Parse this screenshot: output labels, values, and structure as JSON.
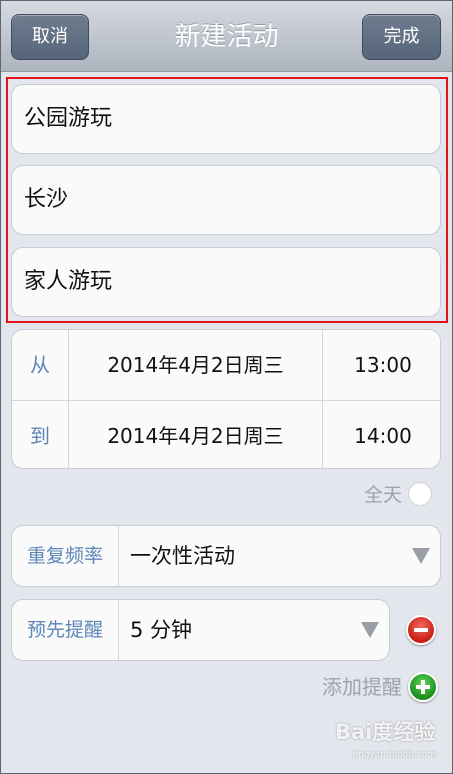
{
  "navbar": {
    "cancel_label": "取消",
    "title": "新建活动",
    "done_label": "完成"
  },
  "event": {
    "title_value": "公园游玩",
    "location_value": "长沙",
    "note_value": "家人游玩"
  },
  "time": {
    "from_label": "从",
    "from_date": "2014年4月2日周三",
    "from_time": "13:00",
    "to_label": "到",
    "to_date": "2014年4月2日周三",
    "to_time": "14:00"
  },
  "all_day": {
    "label": "全天",
    "checked": false
  },
  "repeat": {
    "label": "重复频率",
    "value": "一次性活动"
  },
  "reminder": {
    "label": "预先提醒",
    "value": "5 分钟",
    "add_label": "添加提醒"
  },
  "watermark": {
    "text": "Bai度经验",
    "sub": "jingyan.baidu.com"
  },
  "colors": {
    "highlight": "#e0141d",
    "label_blue": "#5d85b8",
    "remove_red": "#c81d12",
    "add_green": "#1c8e1d"
  },
  "icons": {
    "dropdown": "triangle-down-icon",
    "remove": "minus-circle-icon",
    "add": "plus-circle-icon"
  }
}
